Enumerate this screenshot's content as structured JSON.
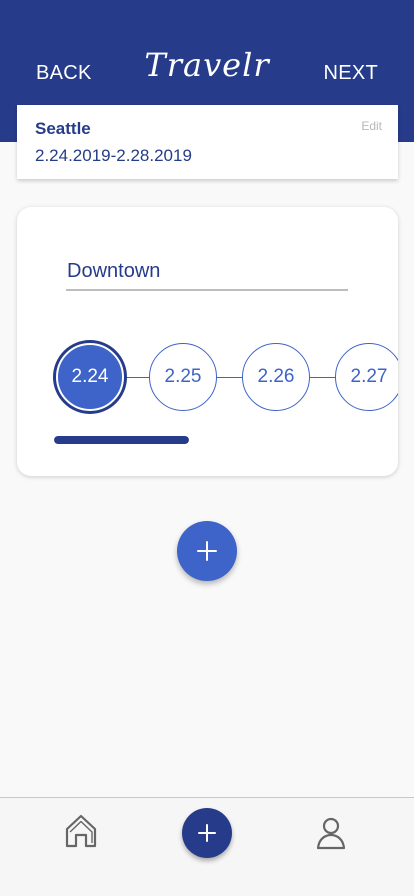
{
  "header": {
    "back_label": "BACK",
    "logo_text": "Travelr",
    "next_label": "NEXT",
    "background_color": "#263c8a"
  },
  "trip": {
    "city": "Seattle",
    "dates": "2.24.2019-2.28.2019",
    "edit_label": "Edit"
  },
  "day_card": {
    "location_value": "Downtown",
    "dates": [
      {
        "label": "2.24",
        "selected": true
      },
      {
        "label": "2.25",
        "selected": false
      },
      {
        "label": "2.26",
        "selected": false
      },
      {
        "label": "2.27",
        "selected": false
      }
    ],
    "progress_fraction": 0.25
  },
  "fab": {
    "icon": "plus-icon"
  },
  "bottom_nav": {
    "items": [
      {
        "icon": "home-icon"
      },
      {
        "icon": "plus-icon"
      },
      {
        "icon": "profile-icon"
      }
    ]
  },
  "colors": {
    "primary_dark": "#263c8a",
    "primary": "#3e63c9",
    "muted": "#b7b7b7"
  }
}
